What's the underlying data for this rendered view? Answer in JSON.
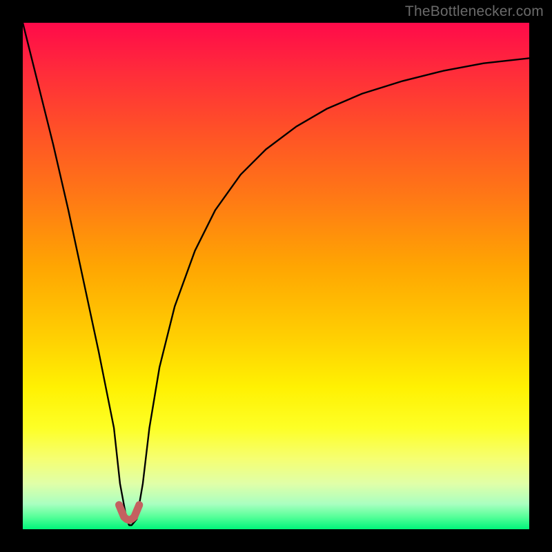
{
  "watermark": "TheBottlenecker.com",
  "colors": {
    "frame": "#000000",
    "curve": "#000000",
    "marker": "#c46060",
    "gradient_top": "#ff0a4a",
    "gradient_bottom": "#00f57a"
  },
  "chart_data": {
    "type": "line",
    "title": "",
    "xlabel": "",
    "ylabel": "",
    "xlim": [
      0,
      100
    ],
    "ylim": [
      0,
      100
    ],
    "grid": false,
    "series": [
      {
        "name": "bottleneck_curve",
        "x": [
          0,
          3,
          6,
          9,
          12,
          15,
          18,
          19.2,
          20.5,
          21.0,
          21.5,
          22.5,
          23.7,
          25,
          27,
          30,
          34,
          38,
          43,
          48,
          54,
          60,
          67,
          75,
          83,
          91,
          100
        ],
        "values": [
          100,
          88,
          76,
          63,
          49,
          35,
          20,
          9,
          2,
          0.8,
          0.8,
          2,
          9,
          20,
          32,
          44,
          55,
          63,
          70,
          75,
          79.5,
          83,
          86,
          88.5,
          90.5,
          92,
          93
        ]
      },
      {
        "name": "marker_dip",
        "x": [
          19.0,
          20.0,
          20.5,
          21.0,
          21.5,
          22.0,
          23.0
        ],
        "values": [
          4.8,
          2.4,
          2.0,
          1.8,
          2.0,
          2.4,
          4.8
        ]
      }
    ],
    "annotations": []
  }
}
